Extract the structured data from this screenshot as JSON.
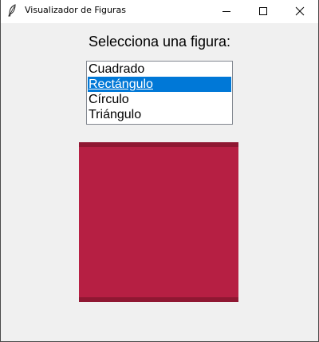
{
  "window": {
    "title": "Visualizador de Figuras",
    "icon": "feather-icon",
    "controls": [
      "minimize-icon",
      "maximize-icon",
      "close-icon"
    ]
  },
  "prompt": "Selecciona una figura:",
  "listbox": {
    "items": [
      "Cuadrado",
      "Rectángulo",
      "Círculo",
      "Triángulo"
    ],
    "selected": "Rectángulo"
  },
  "colors": {
    "selection": "#0078d7",
    "shape_fill": "#b61f43",
    "shape_edge": "#8f1732",
    "background": "#f0f0f0"
  }
}
